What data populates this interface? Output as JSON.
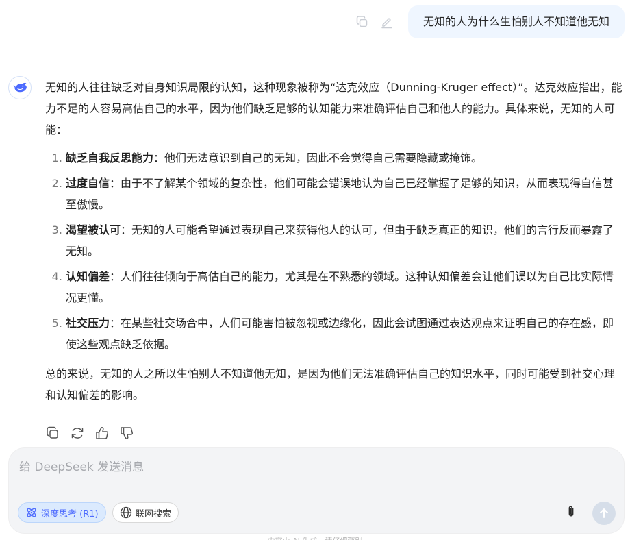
{
  "user_message": "无知的人为什么生怕别人不知道他无知",
  "answer": {
    "intro": "无知的人往往缺乏对自身知识局限的认知，这种现象被称为“达克效应（Dunning-Kruger effect）”。达克效应指出，能力不足的人容易高估自己的水平，因为他们缺乏足够的认知能力来准确评估自己和他人的能力。具体来说，无知的人可能：",
    "items": [
      {
        "title": "缺乏自我反思能力",
        "text": "：他们无法意识到自己的无知，因此不会觉得自己需要隐藏或掩饰。"
      },
      {
        "title": "过度自信",
        "text": "：由于不了解某个领域的复杂性，他们可能会错误地认为自己已经掌握了足够的知识，从而表现得自信甚至傲慢。"
      },
      {
        "title": "渴望被认可",
        "text": "：无知的人可能希望通过表现自己来获得他人的认可，但由于缺乏真正的知识，他们的言行反而暴露了无知。"
      },
      {
        "title": "认知偏差",
        "text": "：人们往往倾向于高估自己的能力，尤其是在不熟悉的领域。这种认知偏差会让他们误以为自己比实际情况更懂。"
      },
      {
        "title": "社交压力",
        "text": "：在某些社交场合中，人们可能害怕被忽视或边缘化，因此会试图通过表达观点来证明自己的存在感，即使这些观点缺乏依据。"
      }
    ],
    "conclusion": "总的来说，无知的人之所以生怕别人不知道他无知，是因为他们无法准确评估自己的知识水平，同时可能受到社交心理和认知偏差的影响。"
  },
  "composer": {
    "placeholder": "给 DeepSeek 发送消息",
    "deep_think_label": "深度思考 (R1)",
    "web_search_label": "联网搜索"
  },
  "footer": "内容由 AI 生成，请仔细甄别",
  "colors": {
    "accent": "#4d6bfe",
    "user_bubble": "#eff6ff",
    "composer_bg": "#f3f4f6"
  },
  "icons": {
    "user_tools": [
      "copy-icon",
      "edit-icon"
    ],
    "avatar": "deepseek-whale-logo",
    "actions": [
      "copy-icon",
      "regenerate-icon",
      "thumbs-up-icon",
      "thumbs-down-icon"
    ],
    "composer": [
      "atom-icon",
      "globe-icon",
      "paperclip-icon",
      "arrow-up-icon"
    ]
  }
}
